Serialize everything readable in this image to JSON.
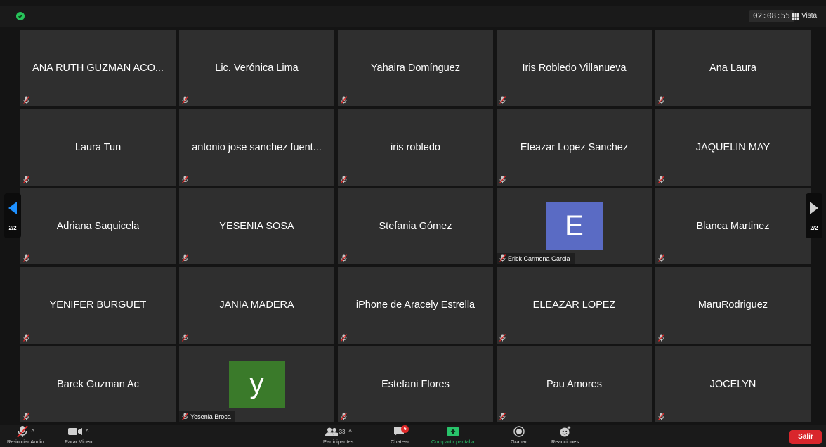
{
  "topbar": {
    "timer": "02:08:55",
    "view_label": "Vista",
    "security_color": "#27c35a"
  },
  "pager": {
    "left_label": "2/2",
    "right_label": "2/2",
    "left_color": "#1e90ff",
    "right_color": "#d0d0d0"
  },
  "participants": [
    {
      "name": "ANA RUTH GUZMAN ACO..."
    },
    {
      "name": "Lic. Verónica Lima"
    },
    {
      "name": "Yahaira Domínguez"
    },
    {
      "name": "Iris Robledo Villanueva"
    },
    {
      "name": "Ana Laura"
    },
    {
      "name": "Laura Tun"
    },
    {
      "name": "antonio jose sanchez fuent..."
    },
    {
      "name": "iris robledo"
    },
    {
      "name": "Eleazar Lopez Sanchez"
    },
    {
      "name": "JAQUELIN MAY"
    },
    {
      "name": "Adriana Saquicela"
    },
    {
      "name": "YESENIA SOSA"
    },
    {
      "name": "Stefania Gómez"
    },
    {
      "name": "Erick Carmona Garcia",
      "avatar_letter": "E",
      "avatar_color": "#5a6bc4"
    },
    {
      "name": "Blanca Martinez"
    },
    {
      "name": "YENIFER BURGUET"
    },
    {
      "name": "JANIA MADERA"
    },
    {
      "name": "iPhone de Aracely Estrella"
    },
    {
      "name": "ELEAZAR LOPEZ"
    },
    {
      "name": "MaruRodriguez"
    },
    {
      "name": "Barek Guzman Ac"
    },
    {
      "name": "Yesenia Broca",
      "avatar_letter": "y",
      "avatar_color": "#3a7a2a"
    },
    {
      "name": "Estefani Flores"
    },
    {
      "name": "Pau Amores"
    },
    {
      "name": "JOCELYN"
    }
  ],
  "toolbar": {
    "audio_label": "Re-iniciar Audio",
    "video_label": "Parar Video",
    "participants_label": "Participantes",
    "participants_count": "33",
    "chat_label": "Chatear",
    "chat_badge": "6",
    "share_label": "Compartir pantalla",
    "record_label": "Grabar",
    "reactions_label": "Reacciones",
    "exit_label": "Salir",
    "share_color": "#28c36a",
    "exit_color": "#d9262c"
  }
}
